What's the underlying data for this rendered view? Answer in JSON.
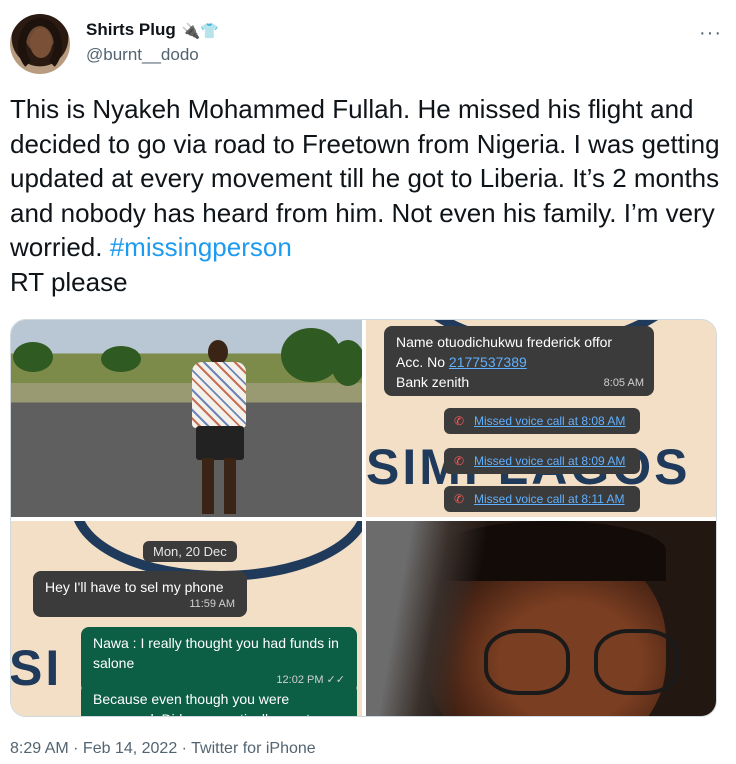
{
  "tweet": {
    "display_name": "Shirts Plug",
    "name_emoji": "🔌👕",
    "handle": "@burnt__dodo",
    "more_label": "···",
    "text": "This is Nyakeh Mohammed Fullah. He missed his flight and decided to go via road to Freetown from Nigeria. I was getting updated at every movement till he got to Liberia. It’s 2 months and nobody has heard from him. Not even his family. I’m very worried. ",
    "hashtag": "#missingperson",
    "text_tail": "RT please",
    "timestamp": "8:29 AM · Feb 14, 2022",
    "separator": " · ",
    "source": "Twitter for iPhone"
  },
  "media": {
    "chat_top": {
      "line1": "Name otuodichukwu frederick offor",
      "acc_prefix": "Acc. No ",
      "acc_number": "2177537389",
      "bank": "Bank zenith",
      "time": "8:05 AM",
      "watermark": "SIMI LAGOS",
      "missed_calls": [
        "Missed voice call at 8:08 AM",
        "Missed voice call at 8:09 AM",
        "Missed voice call at 8:11 AM"
      ]
    },
    "chat_bottom": {
      "date_chip": "Mon, 20 Dec",
      "msg1": "Hey I'll have to sel my phone",
      "msg1_time": "11:59 AM",
      "msg2": "Nawa : I really thought you had funds in salone",
      "msg2_time": "12:02 PM ✓✓",
      "msg3": "Because even though you were scammed. Did you practically empty",
      "watermark": "SI"
    }
  },
  "colors": {
    "text": "#0f1419",
    "secondary": "#536471",
    "hashtag": "#1d9bf0",
    "border": "#cfd9de"
  }
}
